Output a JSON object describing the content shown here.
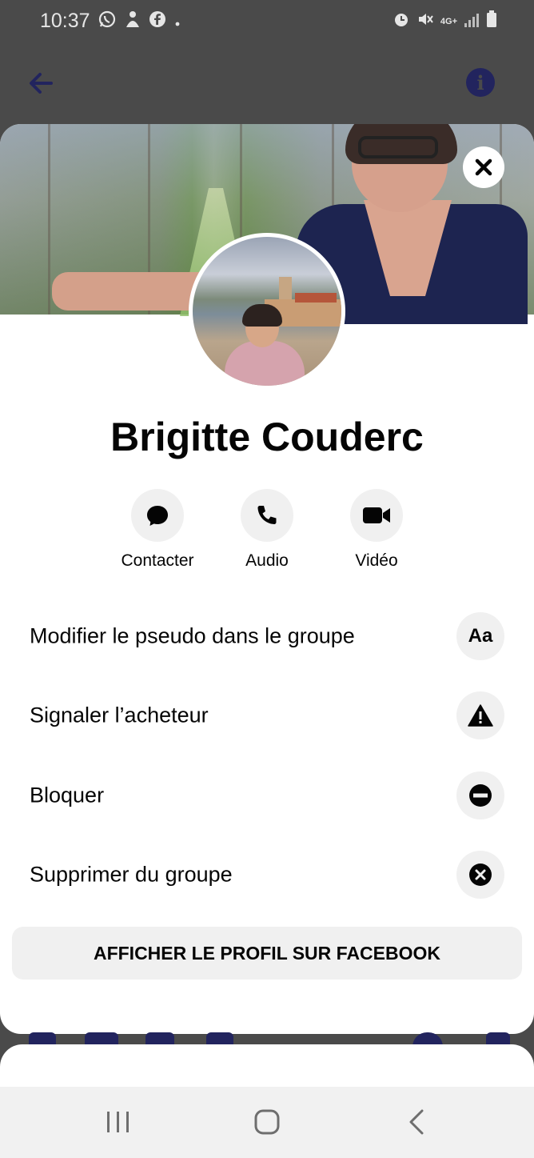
{
  "status_bar": {
    "time": "10:37",
    "left_icons": [
      "whatsapp-icon",
      "app-icon",
      "facebook-icon",
      "dot-icon"
    ],
    "right_icons": [
      "alarm-icon",
      "mute-icon",
      "4g-icon",
      "signal-icon",
      "battery-icon"
    ],
    "network": "4G+"
  },
  "header": {
    "back_icon": "arrow-left-icon",
    "info_icon": "info-icon",
    "accent_color": "#22245e"
  },
  "profile": {
    "name": "Brigitte Couderc",
    "close_icon": "close-icon"
  },
  "actions": [
    {
      "label": "Contacter",
      "icon": "chat-bubble-icon"
    },
    {
      "label": "Audio",
      "icon": "phone-icon"
    },
    {
      "label": "Vidéo",
      "icon": "video-camera-icon"
    }
  ],
  "menu": [
    {
      "label": "Modifier le pseudo dans le groupe",
      "icon": "text-aa-icon",
      "icon_text": "Aa"
    },
    {
      "label": "Signaler l’acheteur",
      "icon": "warning-icon"
    },
    {
      "label": "Bloquer",
      "icon": "block-icon"
    },
    {
      "label": "Supprimer du groupe",
      "icon": "remove-circle-icon"
    }
  ],
  "facebook_button": {
    "label": "AFFICHER LE PROFIL SUR FACEBOOK"
  },
  "nav_bar": {
    "buttons": [
      "recent-apps-icon",
      "home-icon",
      "back-icon"
    ]
  }
}
